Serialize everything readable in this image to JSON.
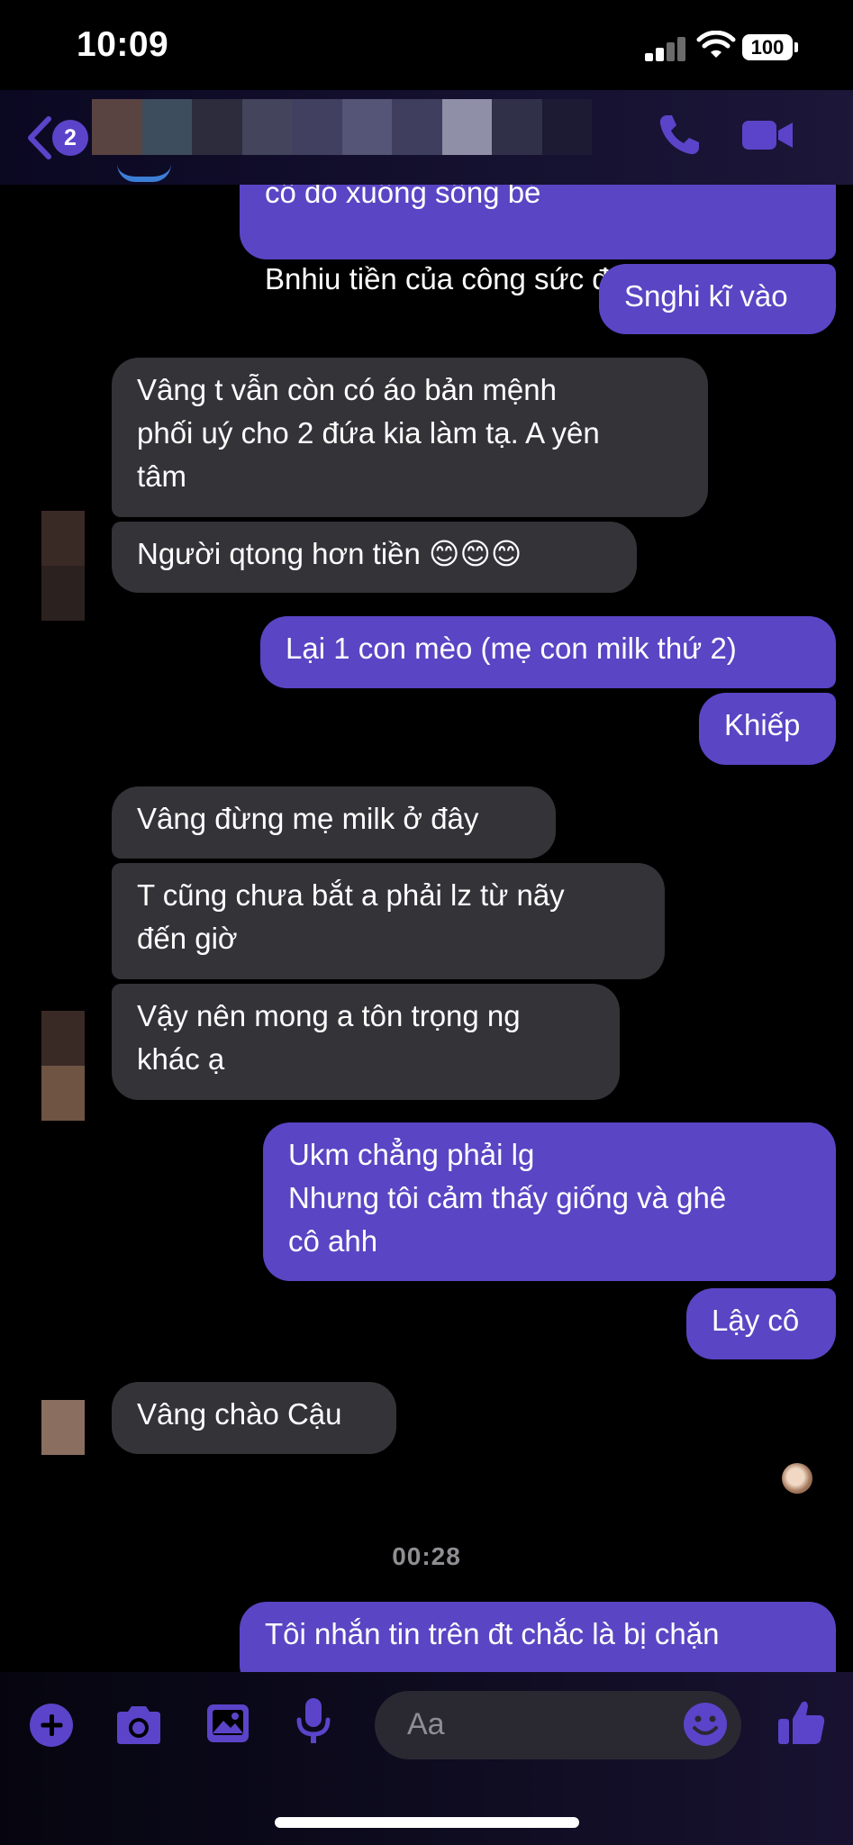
{
  "status_bar": {
    "time": "10:09",
    "battery": "100"
  },
  "header": {
    "unread_count": "2"
  },
  "messages": [
    {
      "text": "cô đó xuống sống bé"
    },
    {
      "text": "Bnhiu tiền của công sức đấy"
    },
    {
      "text": "Snghi kĩ vào"
    },
    {
      "text": "Vâng t vẫn còn có áo bản mệnh\nphối uý cho 2 đứa kia làm tạ. A yên\ntâm"
    },
    {
      "text": "Người qtong hơn tiền 😊😊😊"
    },
    {
      "text": "Lại 1 con mèo (mẹ con milk thứ 2)"
    },
    {
      "text": "Khiếp"
    },
    {
      "text": "Vâng đừng mẹ milk ở đây"
    },
    {
      "text": "T cũng chưa bắt a phải lz từ nãy\nđến giờ"
    },
    {
      "text": "Vậy nên mong a tôn trọng ng\nkhác ạ"
    },
    {
      "text": "Ukm chẳng phải lg\nNhưng tôi cảm thấy giống và ghê\ncô ahh"
    },
    {
      "text": "Lậy cô"
    },
    {
      "text": "Vâng chào Cậu"
    },
    {
      "text": "Tôi nhắn tin trên đt chắc là bị chặn"
    }
  ],
  "timestamp": "00:28",
  "composer": {
    "placeholder": "Aa"
  },
  "icons": {
    "back": "chevron-left-icon",
    "call": "phone-icon",
    "video": "video-camera-icon",
    "plus": "plus-icon",
    "camera": "camera-icon",
    "gallery": "image-icon",
    "mic": "microphone-icon",
    "emoji": "smiley-icon",
    "like": "thumbs-up-icon"
  },
  "colors": {
    "accent": "#5b44c9",
    "outgoing": "#5a45c4",
    "incoming": "#333338",
    "background": "#000000"
  }
}
